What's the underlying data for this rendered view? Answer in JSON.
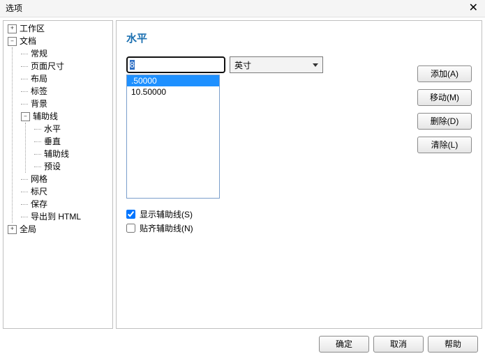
{
  "window": {
    "title": "选项"
  },
  "tree": {
    "workspace": {
      "label": "工作区",
      "expanded": false
    },
    "document": {
      "label": "文档",
      "expanded": true,
      "general": "常规",
      "page_size": "页面尺寸",
      "layout": "布局",
      "tag": "标签",
      "background": "背景",
      "guides": {
        "label": "辅助线",
        "expanded": true,
        "horizontal": "水平",
        "vertical": "垂直",
        "guide": "辅助线",
        "preset": "预设"
      },
      "grid": "网格",
      "ruler": "标尺",
      "save": "保存",
      "export_html": "导出到 HTML"
    },
    "global": {
      "label": "全局",
      "expanded": false
    }
  },
  "panel": {
    "title": "水平",
    "input_value": "8",
    "unit": "英寸",
    "list": [
      ".50000",
      "10.50000"
    ],
    "selected_index": 0,
    "checkbox_show": {
      "label": "显示辅助线(S)",
      "checked": true
    },
    "checkbox_snap": {
      "label": "贴齐辅助线(N)",
      "checked": false
    },
    "btn_add": "添加(A)",
    "btn_move": "移动(M)",
    "btn_delete": "删除(D)",
    "btn_clear": "清除(L)"
  },
  "footer": {
    "ok": "确定",
    "cancel": "取消",
    "help": "帮助"
  }
}
